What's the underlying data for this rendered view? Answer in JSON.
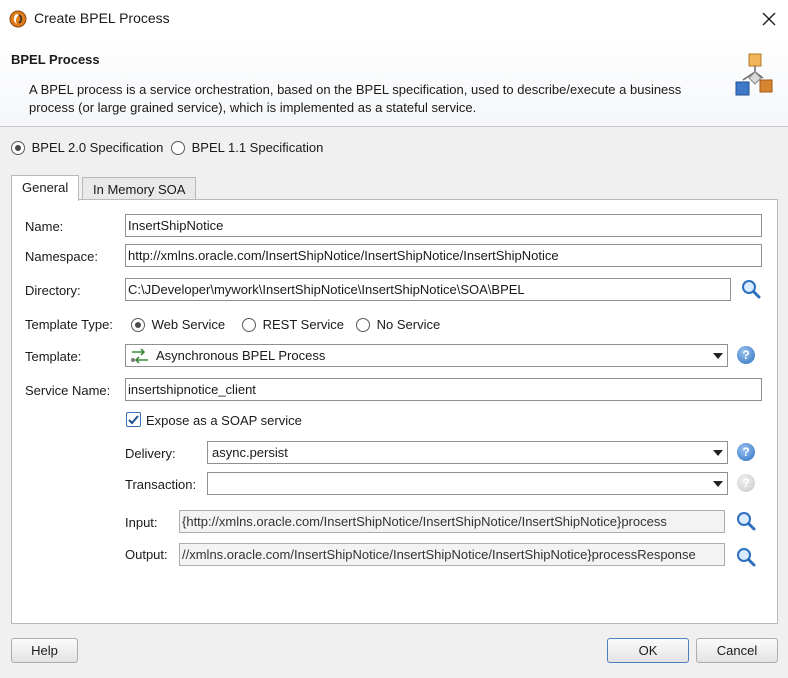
{
  "window": {
    "title": "Create BPEL Process",
    "close_label": "✕"
  },
  "header": {
    "title": "BPEL Process",
    "description": "A BPEL process is a service orchestration, based on the BPEL specification, used to describe/execute a business process (or large grained service), which is implemented as a stateful service."
  },
  "spec": {
    "options": [
      {
        "label": "BPEL 2.0 Specification",
        "selected": true
      },
      {
        "label": "BPEL 1.1 Specification",
        "selected": false
      }
    ]
  },
  "tabs": [
    {
      "label": "General",
      "active": true
    },
    {
      "label": "In Memory SOA",
      "active": false
    }
  ],
  "form": {
    "name": {
      "label": "Name:",
      "value": "InsertShipNotice"
    },
    "namespace": {
      "label": "Namespace:",
      "value": "http://xmlns.oracle.com/InsertShipNotice/InsertShipNotice/InsertShipNotice"
    },
    "directory": {
      "label": "Directory:",
      "value": "C:\\JDeveloper\\mywork\\InsertShipNotice\\InsertShipNotice\\SOA\\BPEL"
    },
    "template_type": {
      "label": "Template Type:",
      "options": [
        {
          "label": "Web Service",
          "selected": true
        },
        {
          "label": "REST Service",
          "selected": false
        },
        {
          "label": "No Service",
          "selected": false
        }
      ]
    },
    "template": {
      "label": "Template:",
      "value": "Asynchronous BPEL Process"
    },
    "service_name": {
      "label": "Service Name:",
      "value": "insertshipnotice_client"
    },
    "expose_soap": {
      "label": "Expose as a SOAP service",
      "checked": true
    },
    "delivery": {
      "label": "Delivery:",
      "value": "async.persist"
    },
    "transaction": {
      "label": "Transaction:",
      "value": ""
    },
    "input": {
      "label": "Input:",
      "value": "{http://xmlns.oracle.com/InsertShipNotice/InsertShipNotice/InsertShipNotice}process"
    },
    "output": {
      "label": "Output:",
      "value": "//xmlns.oracle.com/InsertShipNotice/InsertShipNotice/InsertShipNotice}processResponse"
    }
  },
  "buttons": {
    "help": "Help",
    "ok": "OK",
    "cancel": "Cancel"
  },
  "help_glyph": "?",
  "colors": {
    "accent": "#2c6fbf",
    "panel": "#f0f0f0"
  }
}
